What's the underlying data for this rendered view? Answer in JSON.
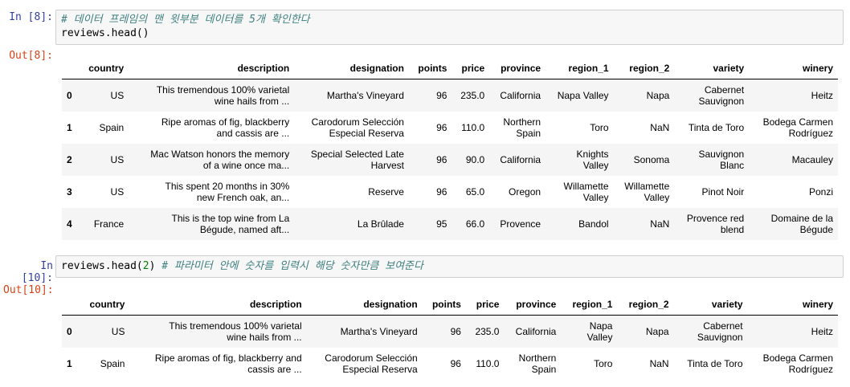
{
  "cells": [
    {
      "in_prompt": "In [8]:",
      "code_comment": "# 데이터 프레임의 맨 윗부분 데이터를 5개 확인한다",
      "code_line": "reviews.head()",
      "out_prompt": "Out[8]:",
      "columns": [
        "",
        "country",
        "description",
        "designation",
        "points",
        "price",
        "province",
        "region_1",
        "region_2",
        "variety",
        "winery"
      ],
      "rows": [
        {
          "idx": "0",
          "country": "US",
          "description": [
            "This tremendous 100% varietal",
            "wine hails from ..."
          ],
          "designation": [
            "Martha's Vineyard"
          ],
          "points": "96",
          "price": "235.0",
          "province": [
            "California"
          ],
          "region_1": [
            "Napa Valley"
          ],
          "region_2": [
            "Napa"
          ],
          "variety": [
            "Cabernet",
            "Sauvignon"
          ],
          "winery": [
            "Heitz"
          ]
        },
        {
          "idx": "1",
          "country": "Spain",
          "description": [
            "Ripe aromas of fig, blackberry",
            "and cassis are ..."
          ],
          "designation": [
            "Carodorum Selección",
            "Especial Reserva"
          ],
          "points": "96",
          "price": "110.0",
          "province": [
            "Northern",
            "Spain"
          ],
          "region_1": [
            "Toro"
          ],
          "region_2": [
            "NaN"
          ],
          "variety": [
            "Tinta de Toro"
          ],
          "winery": [
            "Bodega Carmen",
            "Rodríguez"
          ]
        },
        {
          "idx": "2",
          "country": "US",
          "description": [
            "Mac Watson honors the memory",
            "of a wine once ma..."
          ],
          "designation": [
            "Special Selected Late",
            "Harvest"
          ],
          "points": "96",
          "price": "90.0",
          "province": [
            "California"
          ],
          "region_1": [
            "Knights",
            "Valley"
          ],
          "region_2": [
            "Sonoma"
          ],
          "variety": [
            "Sauvignon",
            "Blanc"
          ],
          "winery": [
            "Macauley"
          ]
        },
        {
          "idx": "3",
          "country": "US",
          "description": [
            "This spent 20 months in 30%",
            "new French oak, an..."
          ],
          "designation": [
            "Reserve"
          ],
          "points": "96",
          "price": "65.0",
          "province": [
            "Oregon"
          ],
          "region_1": [
            "Willamette",
            "Valley"
          ],
          "region_2": [
            "Willamette",
            "Valley"
          ],
          "variety": [
            "Pinot Noir"
          ],
          "winery": [
            "Ponzi"
          ]
        },
        {
          "idx": "4",
          "country": "France",
          "description": [
            "This is the top wine from La",
            "Bégude, named aft..."
          ],
          "designation": [
            "La Brûlade"
          ],
          "points": "95",
          "price": "66.0",
          "province": [
            "Provence"
          ],
          "region_1": [
            "Bandol"
          ],
          "region_2": [
            "NaN"
          ],
          "variety": [
            "Provence red",
            "blend"
          ],
          "winery": [
            "Domaine de la",
            "Bégude"
          ]
        }
      ]
    },
    {
      "in_prompt": "In [10]:",
      "code_call": "reviews.head(",
      "code_arg": "2",
      "code_close": ") ",
      "code_comment": "# 파라미터 안에 숫자를 입력시 해당 숫자만큼 보여준다",
      "out_prompt": "Out[10]:",
      "columns": [
        "",
        "country",
        "description",
        "designation",
        "points",
        "price",
        "province",
        "region_1",
        "region_2",
        "variety",
        "winery"
      ],
      "rows": [
        {
          "idx": "0",
          "country": "US",
          "description": [
            "This tremendous 100% varietal",
            "wine hails from ..."
          ],
          "designation": [
            "Martha's Vineyard"
          ],
          "points": "96",
          "price": "235.0",
          "province": [
            "California"
          ],
          "region_1": [
            "Napa",
            "Valley"
          ],
          "region_2": [
            "Napa"
          ],
          "variety": [
            "Cabernet",
            "Sauvignon"
          ],
          "winery": [
            "Heitz"
          ]
        },
        {
          "idx": "1",
          "country": "Spain",
          "description": [
            "Ripe aromas of fig, blackberry and",
            "cassis are ..."
          ],
          "designation": [
            "Carodorum Selección",
            "Especial Reserva"
          ],
          "points": "96",
          "price": "110.0",
          "province": [
            "Northern",
            "Spain"
          ],
          "region_1": [
            "Toro"
          ],
          "region_2": [
            "NaN"
          ],
          "variety": [
            "Tinta de Toro"
          ],
          "winery": [
            "Bodega Carmen",
            "Rodríguez"
          ]
        }
      ]
    }
  ],
  "colors": {
    "in_prompt": "#303f9f",
    "out_prompt": "#d84315",
    "comment": "#408080",
    "number": "#008000"
  }
}
